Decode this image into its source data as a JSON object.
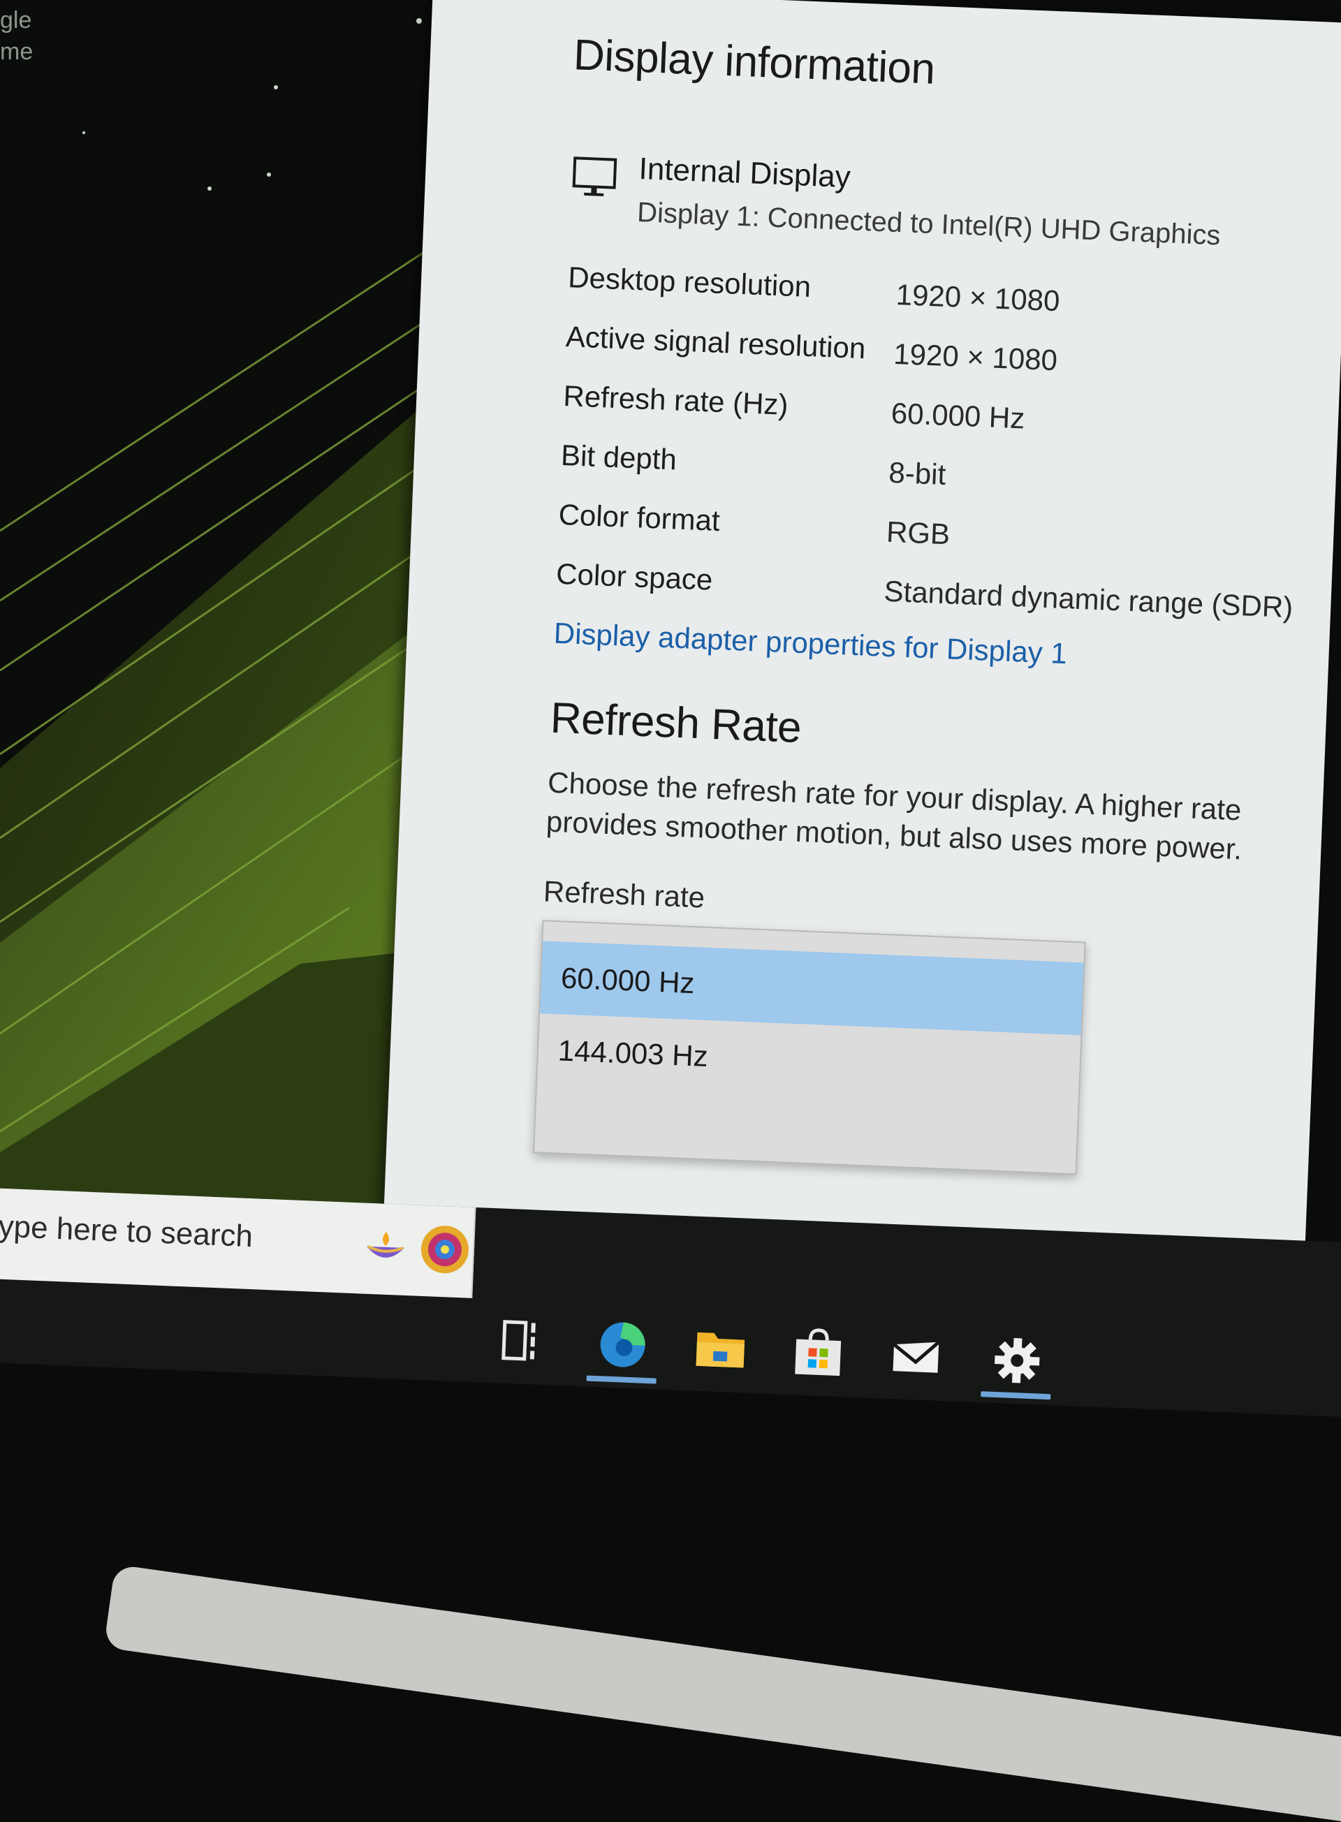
{
  "desktop": {
    "fragment_1": "gle",
    "fragment_2": "me"
  },
  "settings": {
    "display_information": {
      "title": "Display information",
      "monitor_icon": "monitor-icon",
      "display_name": "Internal Display",
      "connection": "Display 1: Connected to Intel(R) UHD Graphics",
      "rows": [
        {
          "label": "Desktop resolution",
          "value": "1920 × 1080"
        },
        {
          "label": "Active signal resolution",
          "value": "1920 × 1080"
        },
        {
          "label": "Refresh rate (Hz)",
          "value": "60.000 Hz"
        },
        {
          "label": "Bit depth",
          "value": "8-bit"
        },
        {
          "label": "Color format",
          "value": "RGB"
        },
        {
          "label": "Color space",
          "value": "Standard dynamic range (SDR)"
        }
      ],
      "adapter_link": "Display adapter properties for Display 1"
    },
    "refresh_rate": {
      "title": "Refresh Rate",
      "description": "Choose the refresh rate for your display. A higher rate provides smoother motion, but also uses more power.",
      "dropdown_label": "Refresh rate",
      "options": [
        "60.000 Hz",
        "144.003 Hz"
      ],
      "selected": "60.000 Hz"
    }
  },
  "taskbar": {
    "search_placeholder": "ype here to search",
    "icons": [
      "diya-icon",
      "rangoli-icon",
      "task-view-icon",
      "edge-icon",
      "file-explorer-icon",
      "store-icon",
      "mail-icon",
      "settings-gear-icon"
    ],
    "active": [
      "edge-icon",
      "settings-gear-icon"
    ]
  },
  "colors": {
    "link": "#1b5fa8",
    "selection": "#9ec8ec",
    "window_bg": "#e9ecec",
    "wallpaper_green": "#5a7a1e"
  }
}
